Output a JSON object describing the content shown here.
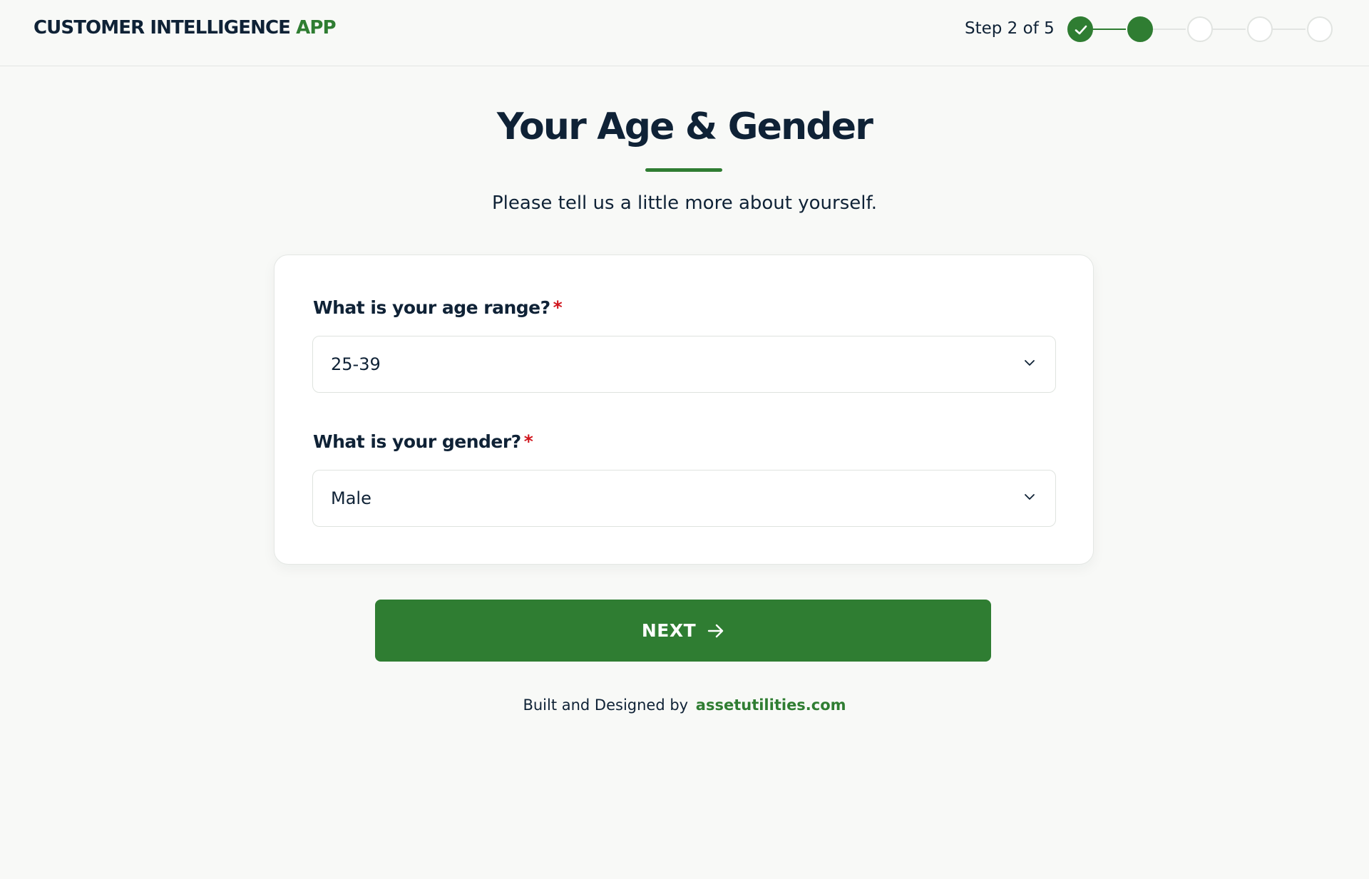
{
  "header": {
    "brand_main": "CUSTOMER INTELLIGENCE",
    "brand_accent": "APP",
    "step_text": "Step 2 of 5",
    "stepper": {
      "total_steps": 5,
      "current_step": 2,
      "completed_icon": "check-icon"
    }
  },
  "main": {
    "title": "Your Age & Gender",
    "subtitle": "Please tell us a little more about yourself."
  },
  "form": {
    "age": {
      "label": "What is your age range?",
      "required_mark": "*",
      "selected_value": "25-39",
      "icon": "chevron-down-icon"
    },
    "gender": {
      "label": "What is your gender?",
      "required_mark": "*",
      "selected_value": "Male",
      "icon": "chevron-down-icon"
    }
  },
  "actions": {
    "next_label": "NEXT",
    "next_icon": "arrow-right-icon"
  },
  "footer": {
    "text": "Built and Designed by",
    "link_text": "assetutilities.com"
  },
  "colors": {
    "accent": "#2f7d32",
    "text_primary": "#0f2236",
    "required": "#d0141c",
    "background": "#f8f9f7"
  }
}
